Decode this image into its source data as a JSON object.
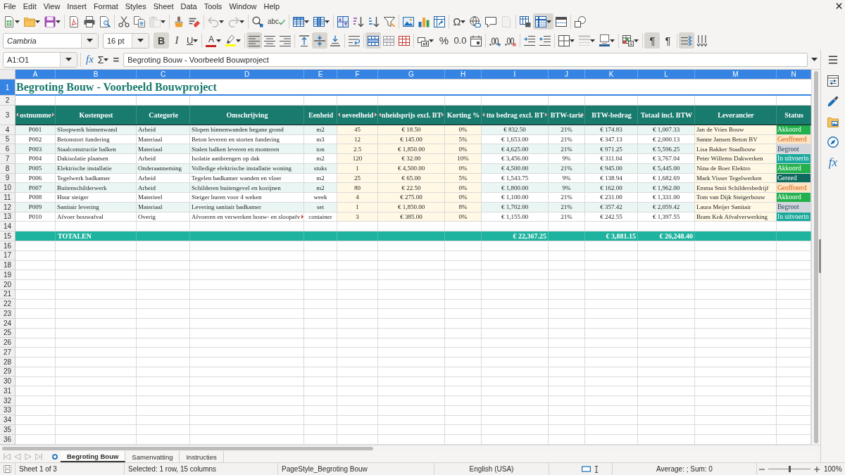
{
  "menu_bar": [
    "File",
    "Edit",
    "View",
    "Insert",
    "Format",
    "Styles",
    "Sheet",
    "Data",
    "Tools",
    "Window",
    "Help"
  ],
  "standard_toolbar": [
    {
      "kind": "icon",
      "pressed": false,
      "dropdown": true,
      "disabled": false
    },
    {
      "kind": "icon",
      "pressed": false,
      "dropdown": true,
      "disabled": false
    },
    {
      "kind": "icon",
      "pressed": false,
      "dropdown": true,
      "disabled": false
    },
    {
      "kind": "icon",
      "pressed": false,
      "dropdown": false,
      "disabled": false
    },
    {
      "kind": "icon",
      "pressed": false,
      "dropdown": false,
      "disabled": false
    },
    {
      "kind": "icon",
      "pressed": false,
      "dropdown": false,
      "disabled": false
    },
    {
      "kind": "icon",
      "pressed": false,
      "dropdown": false,
      "disabled": false
    },
    {
      "kind": "icon",
      "pressed": false,
      "dropdown": false,
      "disabled": false
    },
    {
      "kind": "icon",
      "pressed": false,
      "dropdown": true,
      "disabled": true
    },
    {
      "kind": "icon",
      "pressed": false,
      "dropdown": false,
      "disabled": false
    },
    {
      "kind": "icon",
      "pressed": false,
      "dropdown": false,
      "disabled": false
    },
    {
      "kind": "icon",
      "pressed": false,
      "dropdown": true,
      "disabled": true
    },
    {
      "kind": "icon",
      "pressed": false,
      "dropdown": true,
      "disabled": true
    },
    {
      "kind": "icon",
      "pressed": false,
      "dropdown": false,
      "disabled": false
    },
    {
      "kind": "glyph",
      "text": "abc",
      "pressed": false,
      "dropdown": false,
      "disabled": false
    },
    {
      "kind": "icon",
      "pressed": false,
      "dropdown": true,
      "disabled": false
    },
    {
      "kind": "icon",
      "pressed": false,
      "dropdown": true,
      "disabled": false
    },
    {
      "kind": "icon",
      "pressed": false,
      "dropdown": false,
      "disabled": false
    },
    {
      "kind": "icon",
      "pressed": false,
      "dropdown": false,
      "disabled": false
    },
    {
      "kind": "icon",
      "pressed": false,
      "dropdown": false,
      "disabled": false
    },
    {
      "kind": "icon",
      "pressed": false,
      "dropdown": false,
      "disabled": false
    },
    {
      "kind": "icon",
      "pressed": false,
      "dropdown": false,
      "disabled": false
    },
    {
      "kind": "icon",
      "pressed": false,
      "dropdown": false,
      "disabled": false
    },
    {
      "kind": "icon",
      "pressed": false,
      "dropdown": false,
      "disabled": false
    },
    {
      "kind": "glyph",
      "text": "Ω",
      "pressed": false,
      "dropdown": true,
      "disabled": false
    },
    {
      "kind": "icon",
      "pressed": false,
      "dropdown": false,
      "disabled": false
    },
    {
      "kind": "icon",
      "pressed": false,
      "dropdown": false,
      "disabled": false
    },
    {
      "kind": "icon",
      "pressed": false,
      "dropdown": false,
      "disabled": true
    },
    {
      "kind": "icon",
      "pressed": false,
      "dropdown": false,
      "disabled": false
    },
    {
      "kind": "icon",
      "pressed": true,
      "dropdown": true,
      "disabled": false
    },
    {
      "kind": "icon",
      "pressed": false,
      "dropdown": false,
      "disabled": false
    },
    {
      "kind": "icon",
      "pressed": false,
      "dropdown": false,
      "disabled": false
    }
  ],
  "formatting_toolbar": {
    "font_name": "Cambria",
    "font_size": "16 pt",
    "buttons": [
      {
        "kind": "glyph",
        "text": "B",
        "pressed": true,
        "dropdown": false,
        "disabled": false
      },
      {
        "kind": "glyph",
        "text": "I",
        "pressed": false,
        "dropdown": false,
        "disabled": false
      },
      {
        "kind": "glyph",
        "text": "U",
        "pressed": false,
        "dropdown": true,
        "disabled": false
      },
      {
        "kind": "glyph",
        "text": "A",
        "pressed": false,
        "dropdown": true,
        "disabled": false,
        "color": "#c9211e"
      },
      {
        "kind": "icon",
        "pressed": false,
        "dropdown": true,
        "disabled": false,
        "color": "#ffff00"
      },
      {
        "kind": "icon",
        "pressed": true,
        "dropdown": false,
        "disabled": false
      },
      {
        "kind": "icon",
        "pressed": false,
        "dropdown": false,
        "disabled": false
      },
      {
        "kind": "icon",
        "pressed": false,
        "dropdown": false,
        "disabled": false
      },
      {
        "kind": "icon",
        "pressed": false,
        "dropdown": false,
        "disabled": false
      },
      {
        "kind": "icon",
        "pressed": true,
        "dropdown": false,
        "disabled": false
      },
      {
        "kind": "icon",
        "pressed": false,
        "dropdown": false,
        "disabled": false
      },
      {
        "kind": "icon",
        "pressed": false,
        "dropdown": false,
        "disabled": false
      },
      {
        "kind": "icon",
        "pressed": true,
        "dropdown": false,
        "disabled": false
      },
      {
        "kind": "icon",
        "pressed": false,
        "dropdown": false,
        "disabled": false
      },
      {
        "kind": "icon",
        "pressed": false,
        "dropdown": false,
        "disabled": false
      },
      {
        "kind": "icon",
        "pressed": false,
        "dropdown": true,
        "disabled": false
      },
      {
        "kind": "glyph",
        "text": "%",
        "pressed": false,
        "dropdown": false,
        "disabled": false
      },
      {
        "kind": "glyph",
        "text": "0.0",
        "pressed": false,
        "dropdown": false,
        "disabled": false
      },
      {
        "kind": "icon",
        "pressed": false,
        "dropdown": false,
        "disabled": false
      },
      {
        "kind": "icon",
        "pressed": false,
        "dropdown": false,
        "disabled": false
      },
      {
        "kind": "icon",
        "pressed": false,
        "dropdown": false,
        "disabled": false
      },
      {
        "kind": "icon",
        "pressed": false,
        "dropdown": false,
        "disabled": false
      },
      {
        "kind": "icon",
        "pressed": false,
        "dropdown": false,
        "disabled": false
      },
      {
        "kind": "icon",
        "pressed": false,
        "dropdown": true,
        "disabled": false
      },
      {
        "kind": "icon",
        "pressed": false,
        "dropdown": true,
        "disabled": true
      },
      {
        "kind": "icon",
        "pressed": false,
        "dropdown": true,
        "disabled": false,
        "color": "#2a6099"
      },
      {
        "kind": "icon",
        "pressed": false,
        "dropdown": true,
        "disabled": false
      },
      {
        "kind": "glyph",
        "text": "¶",
        "pressed": true,
        "dropdown": false,
        "disabled": false
      },
      {
        "kind": "glyph",
        "text": "¶",
        "pressed": false,
        "dropdown": false,
        "disabled": false
      },
      {
        "kind": "icon",
        "pressed": true,
        "dropdown": false,
        "disabled": false
      },
      {
        "kind": "icon",
        "pressed": false,
        "dropdown": false,
        "disabled": false
      }
    ]
  },
  "formula_bar": {
    "name_box": "A1:O1",
    "function_wizard": "fx",
    "sum": "Σ",
    "equals": "=",
    "content": "Begroting Bouw - Voorbeeld Bouwproject"
  },
  "sheet": {
    "columns": [
      {
        "label": "A",
        "selected": true
      },
      {
        "label": "B",
        "selected": true
      },
      {
        "label": "C",
        "selected": true
      },
      {
        "label": "D",
        "selected": true
      },
      {
        "label": "E",
        "selected": true
      },
      {
        "label": "F",
        "selected": true
      },
      {
        "label": "G",
        "selected": true
      },
      {
        "label": "H",
        "selected": true
      },
      {
        "label": "I",
        "selected": true
      },
      {
        "label": "J",
        "selected": true
      },
      {
        "label": "K",
        "selected": true
      },
      {
        "label": "L",
        "selected": true
      },
      {
        "label": "M",
        "selected": true
      },
      {
        "label": "N",
        "selected": true
      }
    ],
    "row_numbers": [
      {
        "label": "1",
        "selected": true
      },
      {
        "label": "2",
        "selected": false
      },
      {
        "label": "3",
        "selected": false
      },
      {
        "label": "4",
        "selected": false
      },
      {
        "label": "5",
        "selected": false
      },
      {
        "label": "6",
        "selected": false
      },
      {
        "label": "7",
        "selected": false
      },
      {
        "label": "8",
        "selected": false
      },
      {
        "label": "9",
        "selected": false
      },
      {
        "label": "10",
        "selected": false
      },
      {
        "label": "11",
        "selected": false
      },
      {
        "label": "12",
        "selected": false
      },
      {
        "label": "13",
        "selected": false
      },
      {
        "label": "14",
        "selected": false
      },
      {
        "label": "15",
        "selected": false
      },
      {
        "label": "16",
        "selected": false
      },
      {
        "label": "17",
        "selected": false
      },
      {
        "label": "18",
        "selected": false
      },
      {
        "label": "19",
        "selected": false
      },
      {
        "label": "20",
        "selected": false
      },
      {
        "label": "21",
        "selected": false
      },
      {
        "label": "22",
        "selected": false
      },
      {
        "label": "23",
        "selected": false
      },
      {
        "label": "24",
        "selected": false
      },
      {
        "label": "25",
        "selected": false
      },
      {
        "label": "26",
        "selected": false
      },
      {
        "label": "27",
        "selected": false
      },
      {
        "label": "28",
        "selected": false
      },
      {
        "label": "29",
        "selected": false
      },
      {
        "label": "30",
        "selected": false
      },
      {
        "label": "31",
        "selected": false
      },
      {
        "label": "32",
        "selected": false
      },
      {
        "label": "33",
        "selected": false
      },
      {
        "label": "34",
        "selected": false
      },
      {
        "label": "35",
        "selected": false
      },
      {
        "label": "36",
        "selected": false
      }
    ],
    "title": "Begroting Bouw - Voorbeeld Bouwproject",
    "headers": [
      {
        "text": "ostnumme",
        "clipped_left": true,
        "clipped_right": true
      },
      {
        "text": "Kostenpost",
        "clipped_left": false,
        "clipped_right": false
      },
      {
        "text": "Categorie",
        "clipped_left": false,
        "clipped_right": false
      },
      {
        "text": "Omschrijving",
        "clipped_left": false,
        "clipped_right": false
      },
      {
        "text": "Eenheid",
        "clipped_left": false,
        "clipped_right": false
      },
      {
        "text": "oeveelheid",
        "clipped_left": true,
        "clipped_right": true
      },
      {
        "text": "nheidsprijs excl. BT",
        "clipped_left": true,
        "clipped_right": true
      },
      {
        "text": "Korting %",
        "clipped_left": false,
        "clipped_right": false
      },
      {
        "text": "tto bedrag excl. BT",
        "clipped_left": true,
        "clipped_right": true
      },
      {
        "text": "BTW-tarie",
        "clipped_left": false,
        "clipped_right": true
      },
      {
        "text": "BTW-bedrag",
        "clipped_left": false,
        "clipped_right": false
      },
      {
        "text": "Totaal incl. BTW",
        "clipped_left": false,
        "clipped_right": false
      },
      {
        "text": "Leverancier",
        "clipped_left": false,
        "clipped_right": false
      },
      {
        "text": "Status",
        "clipped_left": false,
        "clipped_right": false
      }
    ],
    "rows": [
      {
        "cells": [
          "P001",
          "Sloopwerk binnenwand",
          "Arbeid",
          "Slopen binnenwanden begane grond",
          "m2",
          "45",
          "€ 18.50",
          "0%",
          "€ 832.50",
          "21%",
          "€ 174.83",
          "€ 1,007.33",
          "Jan de Vries Bouw"
        ],
        "description_clipped": false,
        "status": {
          "text": "Akkoord",
          "color": "#23b14d"
        }
      },
      {
        "cells": [
          "P002",
          "Betonstort fundering",
          "Materiaal",
          "Beton leveren en storten fundering",
          "m3",
          "12",
          "€ 145.00",
          "5%",
          "€ 1,653.00",
          "21%",
          "€ 347.13",
          "€ 2,000.13",
          "Sanne Jansen Beton BV"
        ],
        "description_clipped": false,
        "status": {
          "text": "Geoffreerd",
          "color": "#fde5c3"
        }
      },
      {
        "cells": [
          "P003",
          "Staalconstructie balken",
          "Materiaal",
          "Stalen balken leveren en monteren",
          "ton",
          "2.5",
          "€ 1,850.00",
          "0%",
          "€ 4,625.00",
          "21%",
          "€ 971.25",
          "€ 5,596.25",
          "Lisa Bakker Staalbouw"
        ],
        "description_clipped": false,
        "status": {
          "text": "Begroot",
          "color": "#d3d6dc"
        }
      },
      {
        "cells": [
          "P004",
          "Dakisolatie plaatsen",
          "Arbeid",
          "Isolatie aanbrengen op dak",
          "m2",
          "120",
          "€ 32.00",
          "10%",
          "€ 3,456.00",
          "9%",
          "€ 311.04",
          "€ 3,767.04",
          "Peter Willems Dakwerken"
        ],
        "description_clipped": false,
        "status": {
          "text": "In uitvoerin",
          "color": "#1aa99c"
        }
      },
      {
        "cells": [
          "P005",
          "Elektrische installatie",
          "Onderaanneming",
          "Volledige elektrische installatie woning",
          "stuks",
          "1",
          "€ 4,500.00",
          "0%",
          "€ 4,500.00",
          "21%",
          "€ 945.00",
          "€ 5,445.00",
          "Nina de Boer Elektro"
        ],
        "description_clipped": false,
        "status": {
          "text": "Akkoord",
          "color": "#23b14d"
        }
      },
      {
        "cells": [
          "P006",
          "Tegelwerk badkamer",
          "Arbeid",
          "Tegelen badkamer wanden en vloer",
          "m2",
          "25",
          "€ 65.00",
          "5%",
          "€ 1,543.75",
          "9%",
          "€ 138.94",
          "€ 1,682.69",
          "Mark Visser Tegelwerken"
        ],
        "description_clipped": false,
        "status": {
          "text": "Gereed",
          "color": "#0f6a5e"
        }
      },
      {
        "cells": [
          "P007",
          "Buitenschilderwerk",
          "Arbeid",
          "Schilderen buitengevel en kozijnen",
          "m2",
          "80",
          "€ 22.50",
          "0%",
          "€ 1,800.00",
          "9%",
          "€ 162.00",
          "€ 1,962.00",
          "Emma Smit Schildersbedrijf"
        ],
        "description_clipped": false,
        "status": {
          "text": "Geoffreerd",
          "color": "#fde5c3"
        }
      },
      {
        "cells": [
          "P008",
          "Huur steiger",
          "Materieel",
          "Steiger huren voor 4 weken",
          "week",
          "4",
          "€ 275.00",
          "0%",
          "€ 1,100.00",
          "21%",
          "€ 231.00",
          "€ 1,331.00",
          "Tom van Dijk Steigerbouw"
        ],
        "description_clipped": false,
        "status": {
          "text": "Akkoord",
          "color": "#23b14d"
        }
      },
      {
        "cells": [
          "P009",
          "Sanitair levering",
          "Materiaal",
          "Levering sanitair badkamer",
          "set",
          "1",
          "€ 1,850.00",
          "8%",
          "€ 1,702.00",
          "21%",
          "€ 357.42",
          "€ 2,059.42",
          "Laura Meijer Sanitair"
        ],
        "description_clipped": false,
        "status": {
          "text": "Begroot",
          "color": "#d3d6dc"
        }
      },
      {
        "cells": [
          "P010",
          "Afvoer bouwafval",
          "Overig",
          "Afvoeren en verwerken bouw- en sloopafv",
          "container",
          "3",
          "€ 385.00",
          "0%",
          "€ 1,155.00",
          "21%",
          "€ 242.55",
          "€ 1,397.55",
          "Bram Kok Afvalverwerking"
        ],
        "description_clipped": true,
        "status": {
          "text": "In uitvoerin",
          "color": "#1aa99c"
        }
      }
    ],
    "totals": {
      "label": "TOTALEN",
      "net": "€ 22,367.25",
      "vat": "€ 3,881.15",
      "total": "€ 26,248.40"
    }
  },
  "sheet_tabs": [
    {
      "label": "Begroting Bouw",
      "selected": true
    },
    {
      "label": "Samenvatting",
      "selected": false
    },
    {
      "label": "Instructies",
      "selected": false
    }
  ],
  "sidebar": {
    "tabs": [
      {
        "kind": "icon",
        "selected": false
      },
      {
        "kind": "icon",
        "selected": false
      },
      {
        "kind": "icon",
        "selected": false
      },
      {
        "kind": "icon",
        "selected": false
      },
      {
        "kind": "glyph",
        "text": "fx",
        "selected": false
      }
    ]
  },
  "status_bar": {
    "sheet": "Sheet 1 of 3",
    "selection": "Selected: 1 row, 15 columns",
    "page_style": "PageStyle_Begroting Bouw",
    "language": "English (USA)",
    "summary": "Average: ; Sum: 0",
    "zoom": {
      "level": 0.5,
      "reading": "100%"
    }
  }
}
